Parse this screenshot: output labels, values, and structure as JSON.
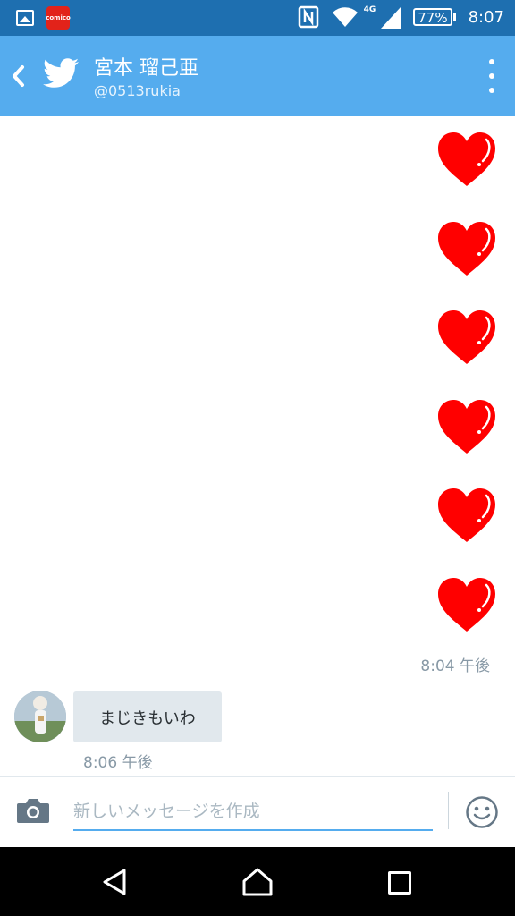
{
  "status_bar": {
    "notification_icons": [
      "gallery-icon",
      "comico-icon"
    ],
    "comico_label": "comico",
    "network": "4G",
    "battery": "77%",
    "time": "8:07"
  },
  "header": {
    "name": "宮本 瑠己亜",
    "handle": "@0513rukia",
    "back_icon": "chevron-left-icon",
    "logo_icon": "twitter-bird-icon",
    "menu_icon": "overflow-menu-icon"
  },
  "conversation": {
    "sent_hearts": [
      "heart",
      "heart",
      "heart",
      "heart",
      "heart",
      "heart"
    ],
    "sent_time": "8:04 午後",
    "received_message": "まじきもいわ",
    "received_time": "8:06 午後"
  },
  "composer": {
    "placeholder": "新しいメッセージを作成",
    "value": "",
    "camera_icon": "camera-icon",
    "emoji_icon": "emoji-icon"
  },
  "colors": {
    "status_bar": "#1e6fb0",
    "header": "#55acee",
    "heart": "#ff0000",
    "bubble": "#e1e8ed",
    "timestamp": "#8899a6"
  }
}
